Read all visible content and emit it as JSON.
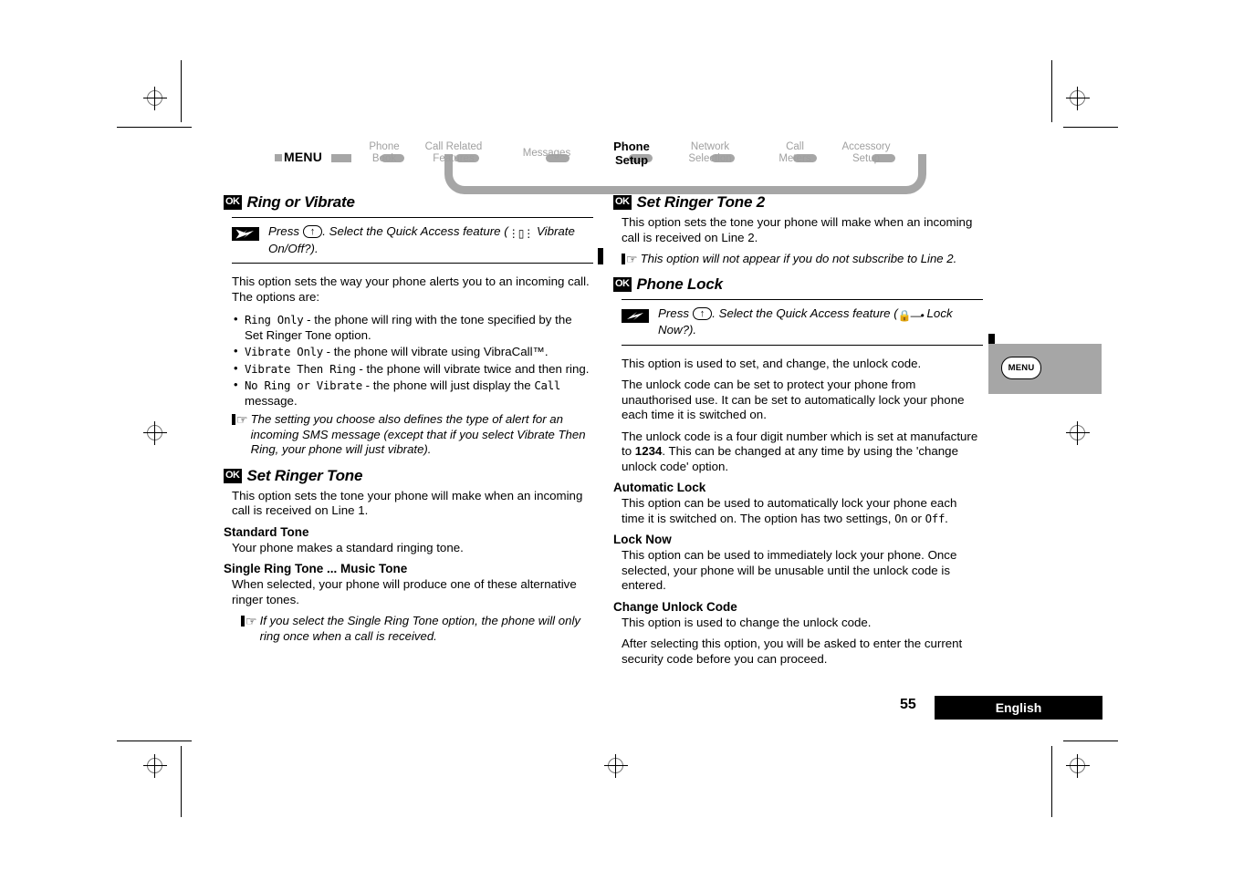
{
  "breadcrumb": {
    "menu_label": "MENU",
    "items": [
      {
        "line1": "Phone",
        "line2": "Book",
        "active": false
      },
      {
        "line1": "Call Related",
        "line2": "Features",
        "active": false
      },
      {
        "line1": "Messages",
        "line2": "",
        "active": false
      },
      {
        "line1": "Phone",
        "line2": "Setup",
        "active": true
      },
      {
        "line1": "Network",
        "line2": "Selection",
        "active": false
      },
      {
        "line1": "Call",
        "line2": "Meters",
        "active": false
      },
      {
        "line1": "Accessory",
        "line2": "Setup",
        "active": false
      }
    ]
  },
  "ok_badge": "OK",
  "left_column": {
    "ring_or_vibrate": {
      "title": "Ring or Vibrate",
      "press_text_1": "Press",
      "press_key": "↑",
      "press_text_2": ". Select the Quick Access feature (",
      "press_icon": "vibrate-phone-icon",
      "press_text_3": " Vibrate On/Off?).",
      "intro": "This option sets the way your phone alerts you to an incoming call. The options are:",
      "options": [
        {
          "code": "Ring Only",
          "desc": " - the phone will ring with the tone specified by the Set Ringer Tone option."
        },
        {
          "code": "Vibrate Only",
          "desc": " - the phone will vibrate using VibraCall™."
        },
        {
          "code": "Vibrate Then Ring",
          "desc": " - the phone will vibrate twice and then ring."
        },
        {
          "code": "No Ring or Vibrate",
          "desc": " - the phone will just display the ",
          "code2": "Call",
          "desc2": " message."
        }
      ],
      "note": "The setting you choose also defines the type of alert for an incoming SMS message (except that if you select Vibrate Then Ring, your phone will just vibrate)."
    },
    "set_ringer_tone": {
      "title": "Set Ringer Tone",
      "intro": "This option sets the tone your phone will make when an incoming call is received on Line 1.",
      "standard_tone": {
        "heading": "Standard Tone",
        "body": "Your phone makes a standard ringing tone."
      },
      "single_ring_tone": {
        "heading": "Single Ring Tone ... Music Tone",
        "body": "When selected, your phone will produce one of these alternative ringer tones.",
        "note": "If you select the Single Ring Tone option, the phone will only ring once when a call is received."
      }
    }
  },
  "right_column": {
    "set_ringer_tone_2": {
      "title": "Set Ringer Tone 2",
      "intro": "This option sets the tone your phone will make when an incoming call is received on Line 2.",
      "note": "This option will not appear if you do not subscribe to Line 2."
    },
    "phone_lock": {
      "title": "Phone Lock",
      "press_text_1": "Press",
      "press_key": "↑",
      "press_text_2": ". Select the Quick Access feature (",
      "press_icon": "padlock-icon",
      "press_text_3": " Lock Now?).",
      "para_1": "This option is used to set, and change, the unlock code.",
      "para_2": "The unlock code can be set to protect your phone from unauthorised use. It can be set to automatically lock your phone each time it is switched on.",
      "para_3_a": "The unlock code is a four digit number which is set at manufacture to ",
      "para_3_code": "1234",
      "para_3_b": ". This can be changed at any time by using the 'change unlock code' option.",
      "automatic_lock": {
        "heading": "Automatic Lock",
        "body_a": "This option can be used to automatically lock your phone each time it is switched on. The option has two settings, ",
        "body_on": "On",
        "body_mid": " or ",
        "body_off": "Off",
        "body_b": "."
      },
      "lock_now": {
        "heading": "Lock Now",
        "body": "This option can be used to immediately lock your phone. Once selected, your phone will be unusable until the unlock code is entered."
      },
      "change_unlock_code": {
        "heading": "Change Unlock Code",
        "body_1": "This option is used to change the unlock code.",
        "body_2": "After selecting this option, you will be asked to enter the current security code before you can proceed."
      }
    }
  },
  "side_tab": {
    "label": "MENU"
  },
  "footer": {
    "page_number": "55",
    "language": "English"
  }
}
